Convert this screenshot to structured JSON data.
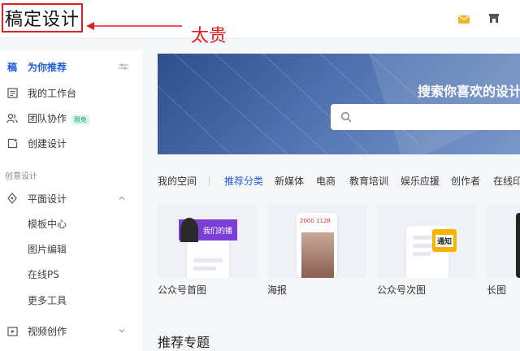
{
  "header": {
    "logo_text": "稿定设计",
    "annotation": "太贵",
    "icons": [
      "gift-box-icon",
      "store-icon"
    ],
    "accent_color": "#1f5cdc",
    "annotation_color": "#e02020"
  },
  "sidebar": {
    "items": [
      {
        "label": "为你推荐",
        "icon": "稿"
      },
      {
        "label": "我的工作台"
      },
      {
        "label": "团队协作",
        "badge": "限免"
      },
      {
        "label": "创建设计"
      }
    ],
    "section_label": "创意设计",
    "design_group": {
      "label": "平面设计"
    },
    "sub_items": [
      "模板中心",
      "图片编辑",
      "在线PS",
      "更多工具"
    ],
    "video_group": {
      "label": "视频创作"
    }
  },
  "banner": {
    "title": "搜索你喜欢的设计",
    "search_placeholder": ""
  },
  "tabs": {
    "space": "我的空间",
    "categories": [
      "推荐分类",
      "新媒体",
      "电商",
      "教育培训",
      "娱乐应援",
      "创作者",
      "在线印"
    ]
  },
  "cards": [
    {
      "label": "公众号首图",
      "overlay_text": "我们的播"
    },
    {
      "label": "海报",
      "overlay_text": "2000 1128"
    },
    {
      "label": "公众号次图",
      "overlay_text": "通知"
    },
    {
      "label": "长图"
    }
  ],
  "section_title": "推荐专题"
}
